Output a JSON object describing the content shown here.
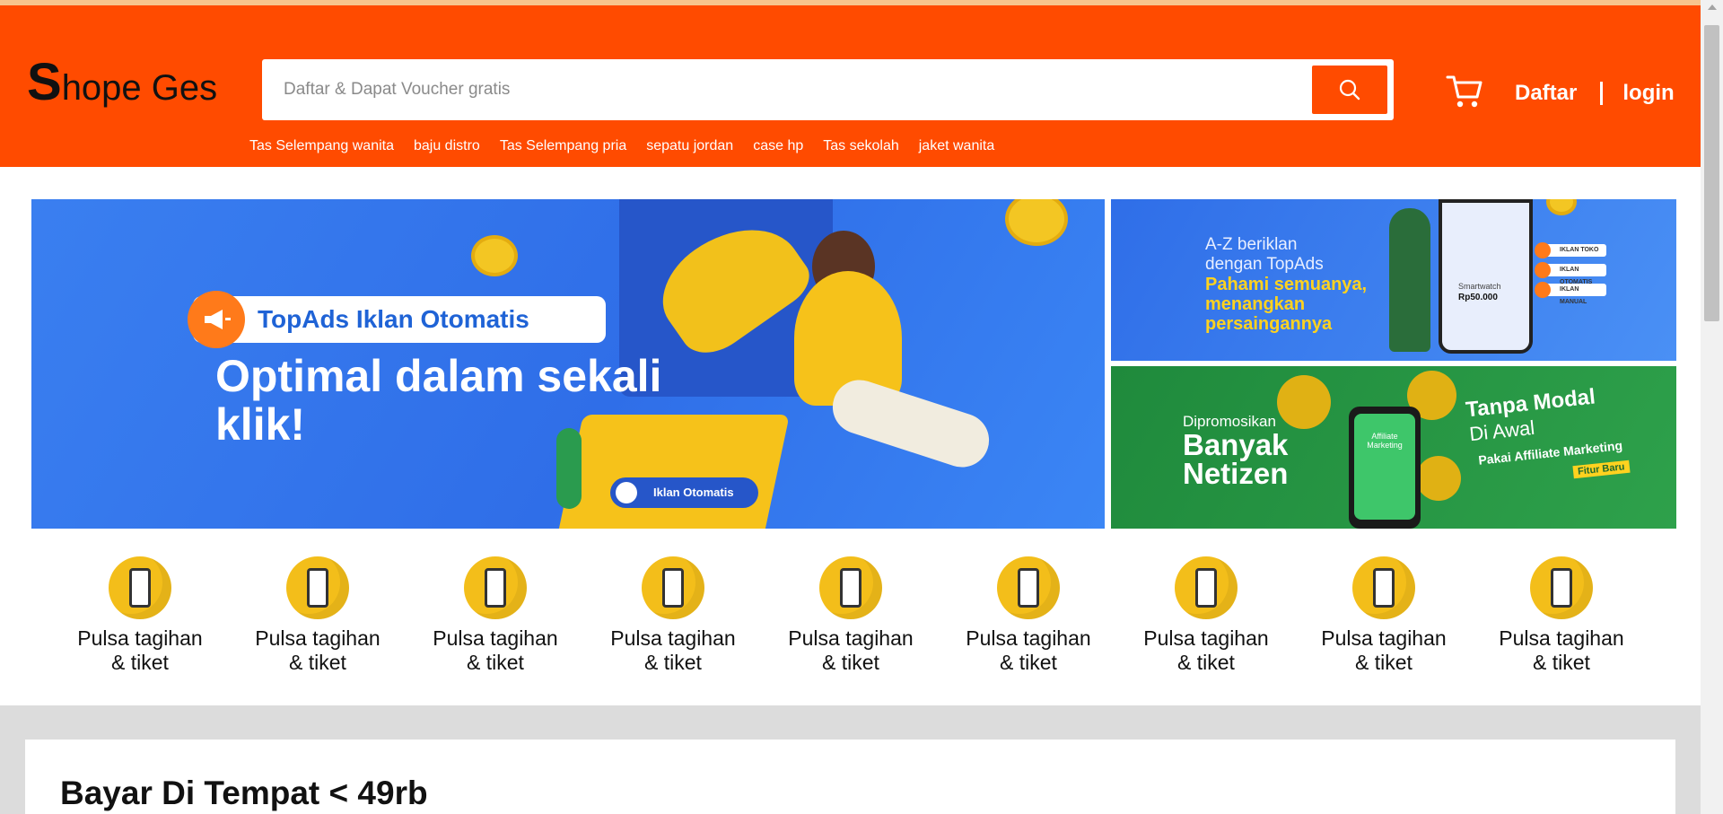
{
  "header": {
    "logo_initial": "S",
    "logo_rest": "hope Ges",
    "search_placeholder": "Daftar & Dapat Voucher gratis",
    "register_label": "Daftar",
    "login_label": "login",
    "suggestions": [
      "Tas Selempang wanita",
      "baju distro",
      "Tas Selempang pria",
      "sepatu jordan",
      "case hp",
      "Tas sekolah",
      "jaket wanita"
    ]
  },
  "banners": {
    "main": {
      "pill_text": "TopAds Iklan Otomatis",
      "headline": "Optimal dalam sekali klik!",
      "toggle_text": "Iklan Otomatis"
    },
    "side_top": {
      "line1": "A-Z beriklan",
      "line2": "dengan TopAds",
      "line3": "Pahami semuanya,",
      "line4": "menangkan",
      "line5": "persaingannya",
      "tags": [
        "IKLAN TOKO",
        "IKLAN OTOMATIS",
        "IKLAN MANUAL"
      ],
      "product_name": "Smartwatch",
      "product_price": "Rp50.000"
    },
    "side_bottom": {
      "small": "Dipromosikan",
      "big1": "Banyak",
      "big2": "Netizen",
      "phone_text": "Affiliate Marketing",
      "right1": "Tanpa Modal",
      "right2": "Di Awal",
      "right3": "Pakai Affiliate Marketing",
      "badge": "Fitur Baru"
    }
  },
  "categories": [
    {
      "line1": "Pulsa tagihan",
      "line2": "& tiket"
    },
    {
      "line1": "Pulsa tagihan",
      "line2": "& tiket"
    },
    {
      "line1": "Pulsa tagihan",
      "line2": "& tiket"
    },
    {
      "line1": "Pulsa tagihan",
      "line2": "& tiket"
    },
    {
      "line1": "Pulsa tagihan",
      "line2": "& tiket"
    },
    {
      "line1": "Pulsa tagihan",
      "line2": "& tiket"
    },
    {
      "line1": "Pulsa tagihan",
      "line2": "& tiket"
    },
    {
      "line1": "Pulsa tagihan",
      "line2": "& tiket"
    },
    {
      "line1": "Pulsa tagihan",
      "line2": "& tiket"
    }
  ],
  "section": {
    "title": "Bayar Di Tempat < 49rb"
  },
  "colors": {
    "brand": "#ff4b00",
    "category_icon": "#f3be1a",
    "page_bg": "#dcdcdc"
  },
  "icons": {
    "search": "search-icon",
    "cart": "cart-icon",
    "category": "phone-icon"
  }
}
